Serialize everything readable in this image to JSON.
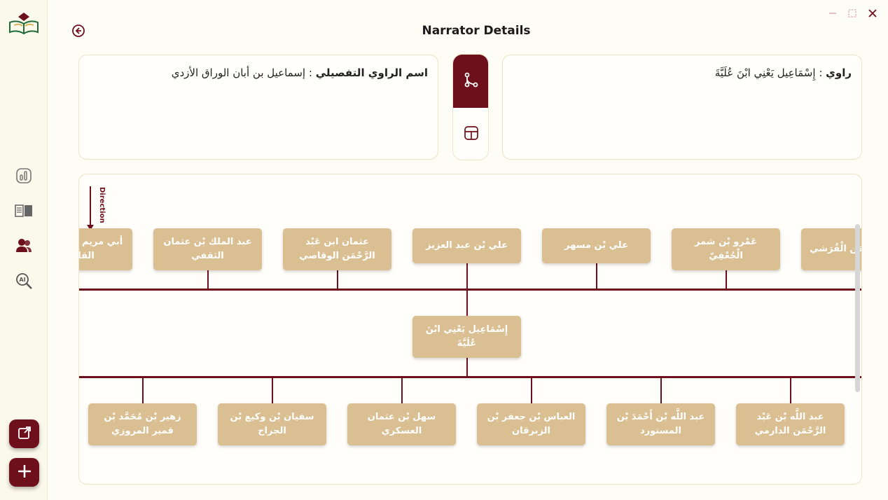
{
  "window": {
    "title": "Narrator Details"
  },
  "info": {
    "detailed_label": "اسم الراوي التفصيلي",
    "detailed_value": "إسماعيل بن أبان الوراق الأزدي",
    "narrator_label": "راوي",
    "narrator_value": "إِسْمَاعِيل  يَعْنِي ابْنَ عُلَيَّةَ"
  },
  "graph": {
    "direction_label": "Direction",
    "center_node": "إِسْمَاعِيل  يَعْنِي ابْنَ عُلَيَّةَ",
    "top_nodes": [
      "عَبْد الرَّحْمَن الْقُرَشي",
      "عَمْرو بْن شمر الْجُعْفِيّ",
      "علي بْن مسهر",
      "علي بْن عبد العزيز",
      "عثمان ابن عَبْد الرَّحْمَن الوقاصي",
      "عبد الملك بْن عثمان الثقفي",
      "أبي مريم عبد الغفار القاسم"
    ],
    "bottom_nodes": [
      "عبد اللَّه بْن عَبْد الرَّحْمَن الدارمي",
      "عبد اللَّه بْن أَحْمَدَ بْن المستورد",
      "العباس بْن جعفر بْن الزبرقان",
      "سهل بْن عثمان العسكري",
      "سفيان بْن وكيع بْن الجراح",
      "زهير بْن مُحَمَّد بْن قمير المروزي"
    ]
  },
  "icons": {
    "logo": "book-logo-icon",
    "nav": [
      "statistics-icon",
      "book-icon",
      "users-icon",
      "ai-search-icon"
    ],
    "fab": [
      "external-link-icon",
      "plus-icon"
    ]
  },
  "colors": {
    "accent": "#6e0f1c",
    "node": "#d9bf92",
    "background": "#fdfcf5"
  }
}
